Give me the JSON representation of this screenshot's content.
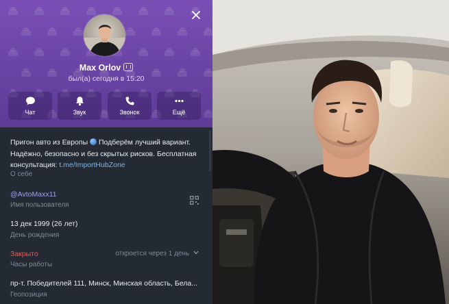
{
  "profile": {
    "name": "Max Orlov",
    "status": "был(а) сегодня в 15:20",
    "close_icon": "close-icon",
    "actions": [
      {
        "label": "Чат",
        "icon": "chat-icon"
      },
      {
        "label": "Звук",
        "icon": "bell-icon"
      },
      {
        "label": "Звонок",
        "icon": "phone-icon"
      },
      {
        "label": "Ещё",
        "icon": "more-icon"
      }
    ]
  },
  "info": {
    "bio_line1": "Пригон авто из Европы",
    "bio_line1b": "Подберём лучший вариант.",
    "bio_line2": "Надёжно, безопасно и без скрытых рисков. Бесплатная",
    "bio_line3_prefix": "консультация: ",
    "bio_link": "t.me/ImportHubZone",
    "bio_caption": "О себе",
    "username": "@AvtoMaxx11",
    "username_caption": "Имя пользователя",
    "birthday": "13 дек 1999 (26 лет)",
    "birthday_caption": "День рождения",
    "hours_status": "Закрыто",
    "hours_next": "откроется через 1 день",
    "hours_caption": "Часы работы",
    "address": "пр-т. Победителей 111, Минск, Минская область, Бела...",
    "address_caption": "Геопозиция"
  },
  "colors": {
    "header_purple": "#6a44a4",
    "panel_bg": "#232a33",
    "link": "#7cb4ec",
    "closed_red": "#ef5b5b"
  }
}
